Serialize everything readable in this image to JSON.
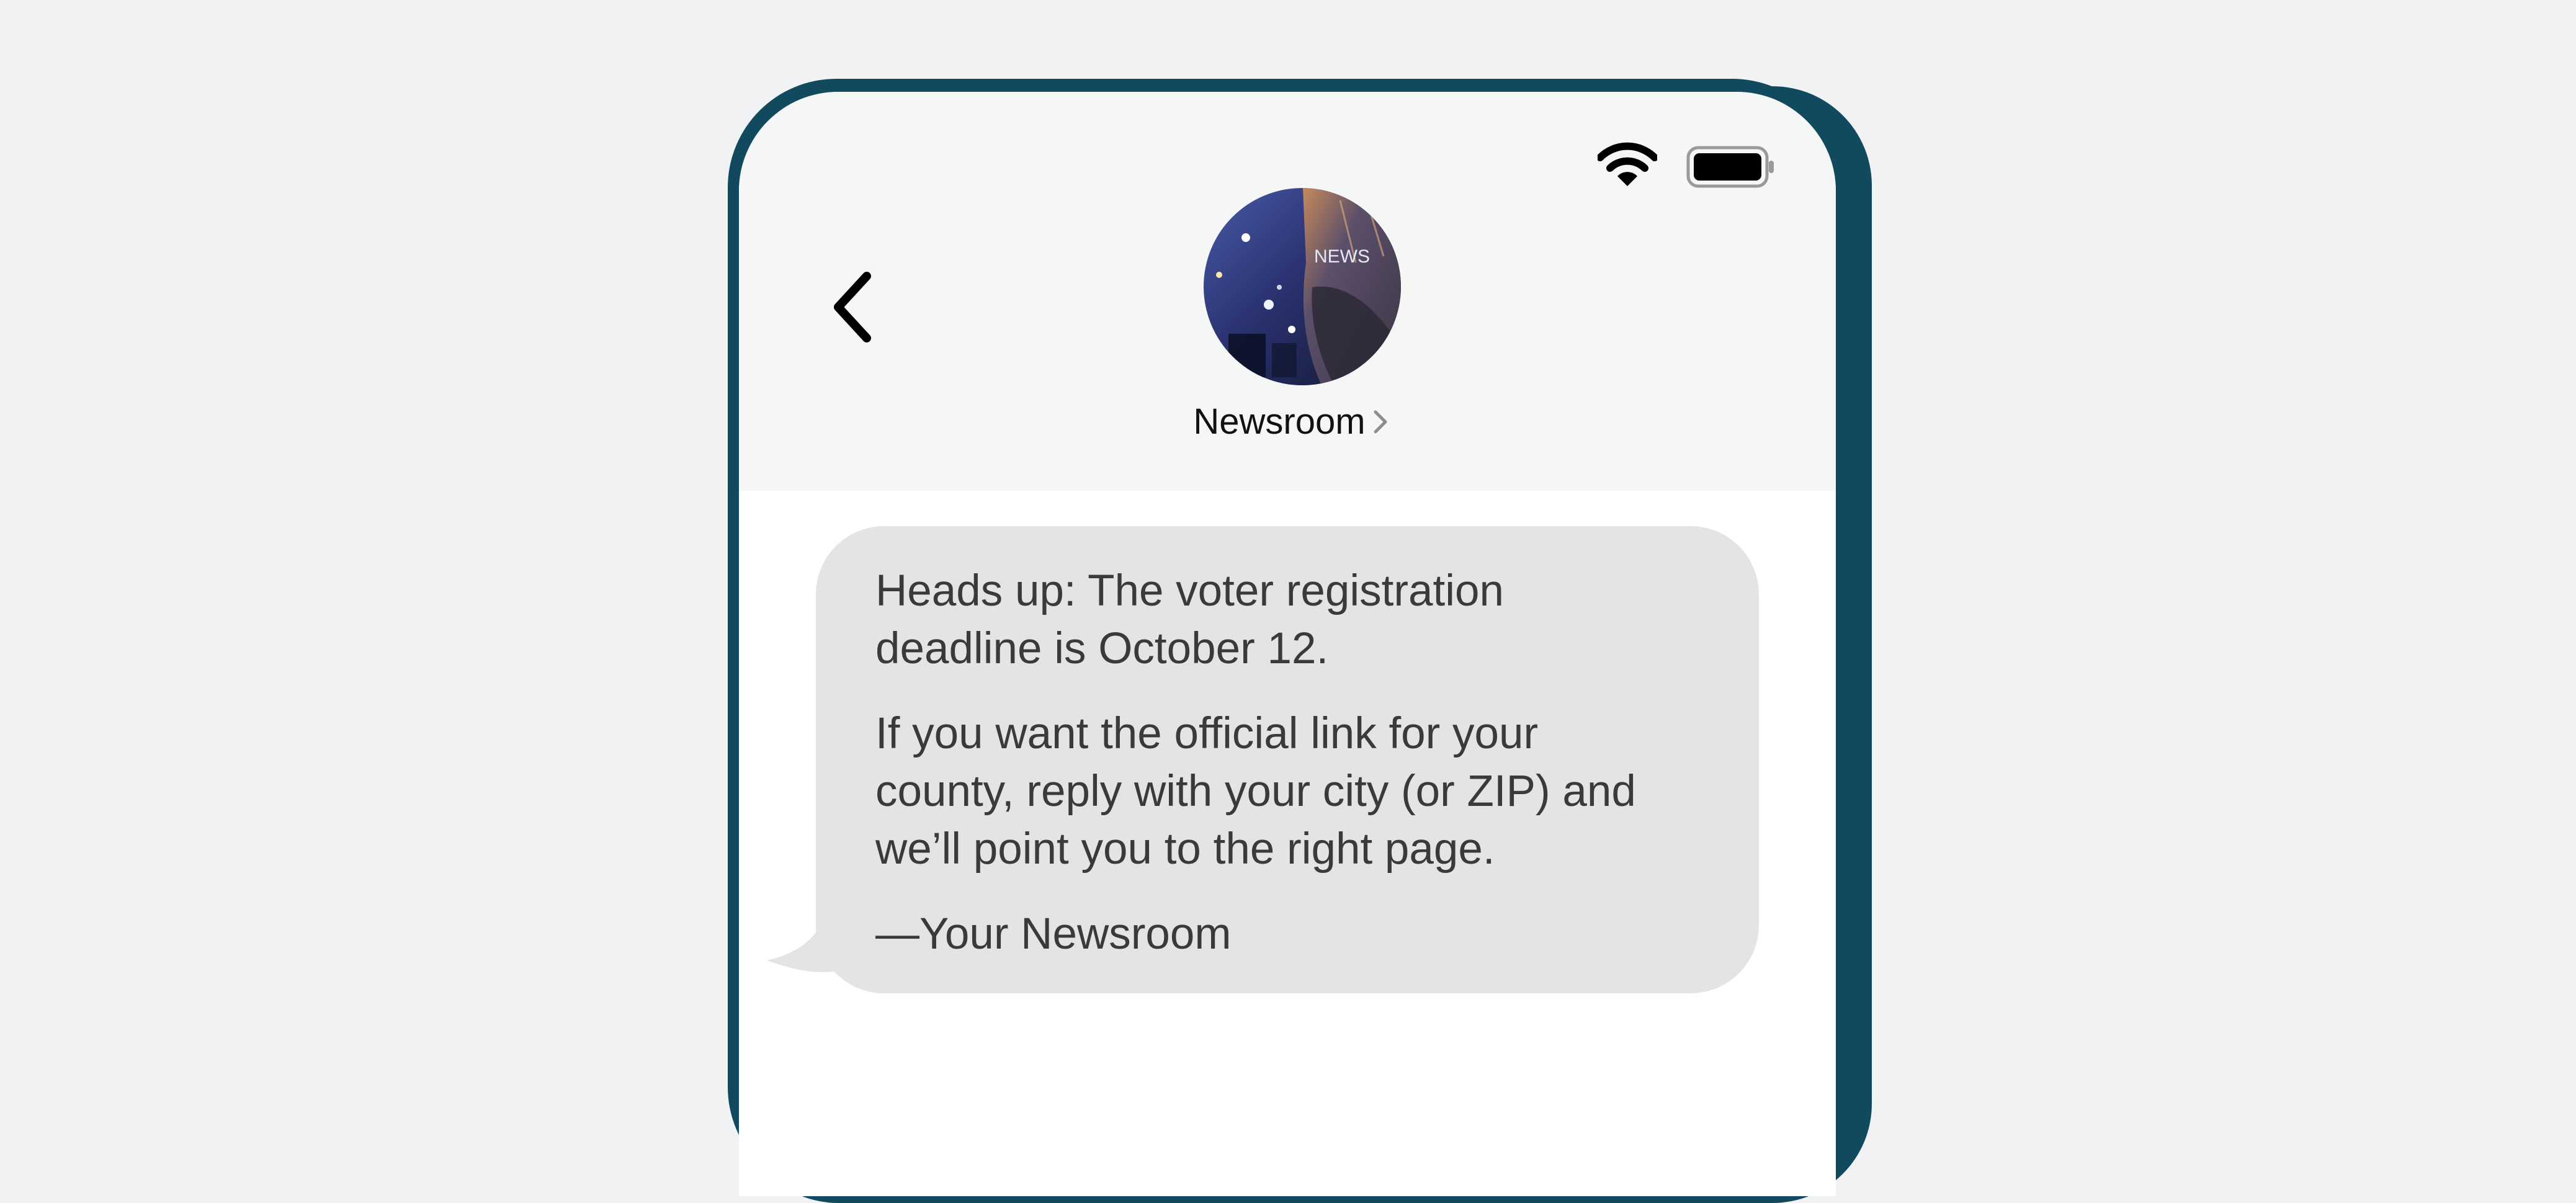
{
  "status_bar": {
    "wifi_icon": "wifi-icon",
    "battery_icon": "battery-icon"
  },
  "header": {
    "back_icon": "chevron-left-icon",
    "avatar_label": "NEWS",
    "contact_name": "Newsroom",
    "contact_chevron_icon": "chevron-right-icon"
  },
  "message": {
    "paragraph_1": "Heads up: The voter registration\ndeadline is October 12.",
    "paragraph_2": "If you want the official link for your\ncounty, reply with your city (or ZIP) and\nwe’ll point you to the right page.",
    "signature": "—Your Newsroom"
  },
  "colors": {
    "background": "#f1f2f4",
    "phone_frame": "#114a5e",
    "header_bg": "#f5f7f7",
    "bubble_bg": "#e4e4e4",
    "bubble_text": "#3a3a3c"
  }
}
